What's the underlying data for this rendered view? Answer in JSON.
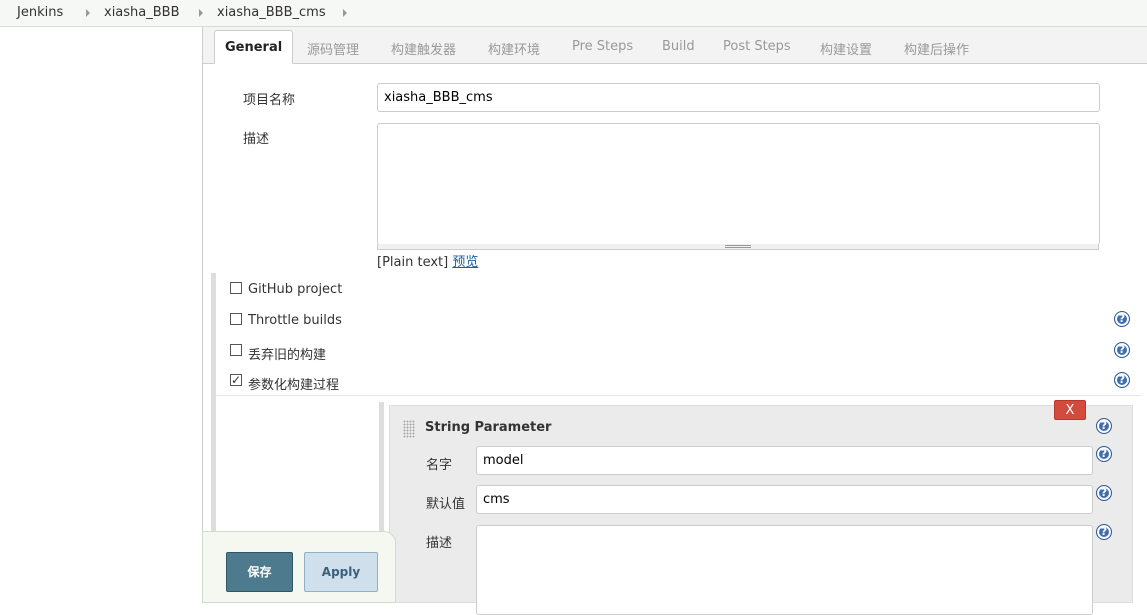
{
  "breadcrumb": {
    "items": [
      "Jenkins",
      "xiasha_BBB",
      "xiasha_BBB_cms"
    ]
  },
  "tabs": [
    "General",
    "源码管理",
    "构建触发器",
    "构建环境",
    "Pre Steps",
    "Build",
    "Post Steps",
    "构建设置",
    "构建后操作"
  ],
  "general": {
    "project_name_label": "项目名称",
    "project_name_value": "xiasha_BBB_cms",
    "description_label": "描述",
    "description_value": "",
    "plain_text_note": "[Plain text]",
    "preview_link": "预览"
  },
  "options": [
    {
      "label": "GitHub project",
      "checked": false
    },
    {
      "label": "Throttle builds",
      "checked": false
    },
    {
      "label": "丢弃旧的构建",
      "checked": false
    },
    {
      "label": "参数化构建过程",
      "checked": true
    }
  ],
  "string_parameter": {
    "title": "String Parameter",
    "delete_label": "X",
    "name_label": "名字",
    "name_value": "model",
    "default_label": "默认值",
    "default_value": "cms",
    "description_label": "描述",
    "description_value": ""
  },
  "buttons": {
    "save": "保存",
    "apply": "Apply"
  },
  "colors": {
    "save_button": "#4d7a8c",
    "apply_button": "#cfe0ec",
    "delete_button": "#d24b3c",
    "help_icon": "#3f6fae"
  }
}
